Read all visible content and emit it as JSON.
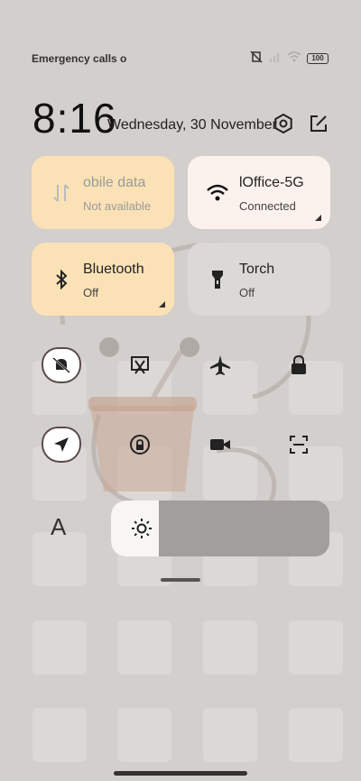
{
  "status_bar": {
    "left_text": "Emergency calls o",
    "battery": "100"
  },
  "header": {
    "time": "8:16",
    "date": "Wednesday, 30 November",
    "settings_icon": "gear-hex-icon",
    "edit_icon": "edit-icon"
  },
  "tiles": [
    {
      "name": "mobile-data",
      "title": "obile data",
      "subtitle": "Not available",
      "icon": "mobile-data-icon",
      "active": true,
      "color": "#fbe2b6"
    },
    {
      "name": "wifi",
      "title": "lOffice-5G",
      "subtitle": "Connected",
      "icon": "wifi-icon",
      "active": true,
      "color": "#fbf1ed"
    },
    {
      "name": "bluetooth",
      "title": "Bluetooth",
      "subtitle": "Off",
      "icon": "bluetooth-icon",
      "active": true,
      "color": "#fbe2b6"
    },
    {
      "name": "torch",
      "title": "Torch",
      "subtitle": "Off",
      "icon": "torch-icon",
      "active": false,
      "color": "#dcd8d5"
    }
  ],
  "quick_toggles": [
    "mute-icon",
    "screenshot-icon",
    "airplane-icon",
    "lock-icon",
    "location-icon",
    "rotation-lock-icon",
    "video-icon",
    "scan-icon"
  ],
  "font_button": "A",
  "brightness": {
    "level": 0.22,
    "icon": "sun-icon"
  }
}
